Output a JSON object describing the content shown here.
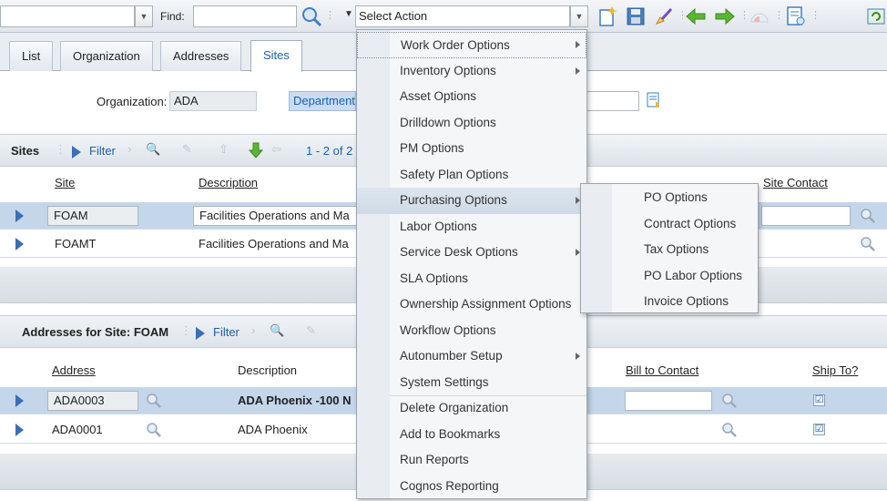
{
  "toolbar": {
    "find_label": "Find:",
    "find_value": "",
    "select_action": "Select Action",
    "icons": [
      "new-record-icon",
      "save-icon",
      "clear-icon",
      "previous-icon",
      "next-icon",
      "dashboard-icon",
      "report-icon",
      "refresh-icon"
    ]
  },
  "tabs": [
    {
      "label": "List",
      "active": false
    },
    {
      "label": "Organization",
      "active": false
    },
    {
      "label": "Addresses",
      "active": false
    },
    {
      "label": "Sites",
      "active": true
    }
  ],
  "header": {
    "organization_label": "Organization:",
    "organization_value": "ADA",
    "department_value": "Department"
  },
  "sites": {
    "title": "Sites",
    "filter_label": "Filter",
    "paging": "1 - 2 of 2",
    "columns": {
      "site": "Site",
      "description": "Description",
      "site_contact": "Site Contact"
    },
    "rows": [
      {
        "site": "FOAM",
        "description": "Facilities Operations and Ma"
      },
      {
        "site": "FOAMT",
        "description": "Facilities Operations and Ma"
      }
    ]
  },
  "addresses": {
    "title": "Addresses for Site: FOAM",
    "filter_label": "Filter",
    "columns": {
      "address": "Address",
      "description": "Description",
      "bill_to_contact": "Bill to Contact",
      "ship_to": "Ship To?"
    },
    "rows": [
      {
        "address": "ADA0003",
        "description": "ADA Phoenix -100 N",
        "ship_to": "☑"
      },
      {
        "address": "ADA0001",
        "description": "ADA Phoenix",
        "ship_to": "☑"
      }
    ]
  },
  "action_menu": {
    "items": [
      {
        "label": "Work Order Options",
        "submenu": true
      },
      {
        "label": "Inventory Options",
        "submenu": true
      },
      {
        "label": "Asset Options",
        "submenu": false
      },
      {
        "label": "Drilldown Options",
        "submenu": false
      },
      {
        "label": "PM Options",
        "submenu": false
      },
      {
        "label": "Safety Plan Options",
        "submenu": false
      },
      {
        "label": "Purchasing Options",
        "submenu": true
      },
      {
        "label": "Labor Options",
        "submenu": false
      },
      {
        "label": "Service Desk Options",
        "submenu": true
      },
      {
        "label": "SLA Options",
        "submenu": false
      },
      {
        "label": "Ownership Assignment Options",
        "submenu": false
      },
      {
        "label": "Workflow Options",
        "submenu": false
      },
      {
        "label": "Autonumber Setup",
        "submenu": true
      },
      {
        "label": "System Settings",
        "submenu": false
      },
      {
        "label": "Delete Organization",
        "submenu": false
      },
      {
        "label": "Add to Bookmarks",
        "submenu": false
      },
      {
        "label": "Run Reports",
        "submenu": false
      },
      {
        "label": "Cognos Reporting",
        "submenu": false
      }
    ]
  },
  "purchasing_submenu": {
    "items": [
      "PO Options",
      "Contract Options",
      "Tax Options",
      "PO Labor Options",
      "Invoice Options"
    ]
  }
}
